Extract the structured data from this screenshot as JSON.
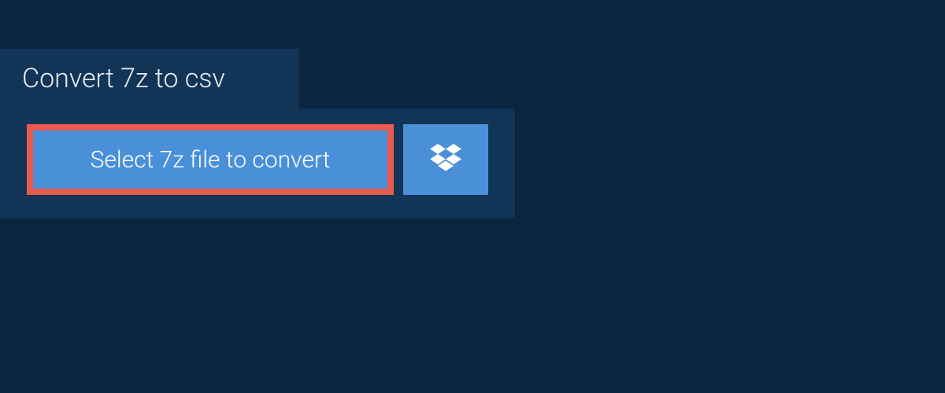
{
  "tab": {
    "title": "Convert 7z to csv"
  },
  "actions": {
    "select_label": "Select 7z file to convert"
  }
}
